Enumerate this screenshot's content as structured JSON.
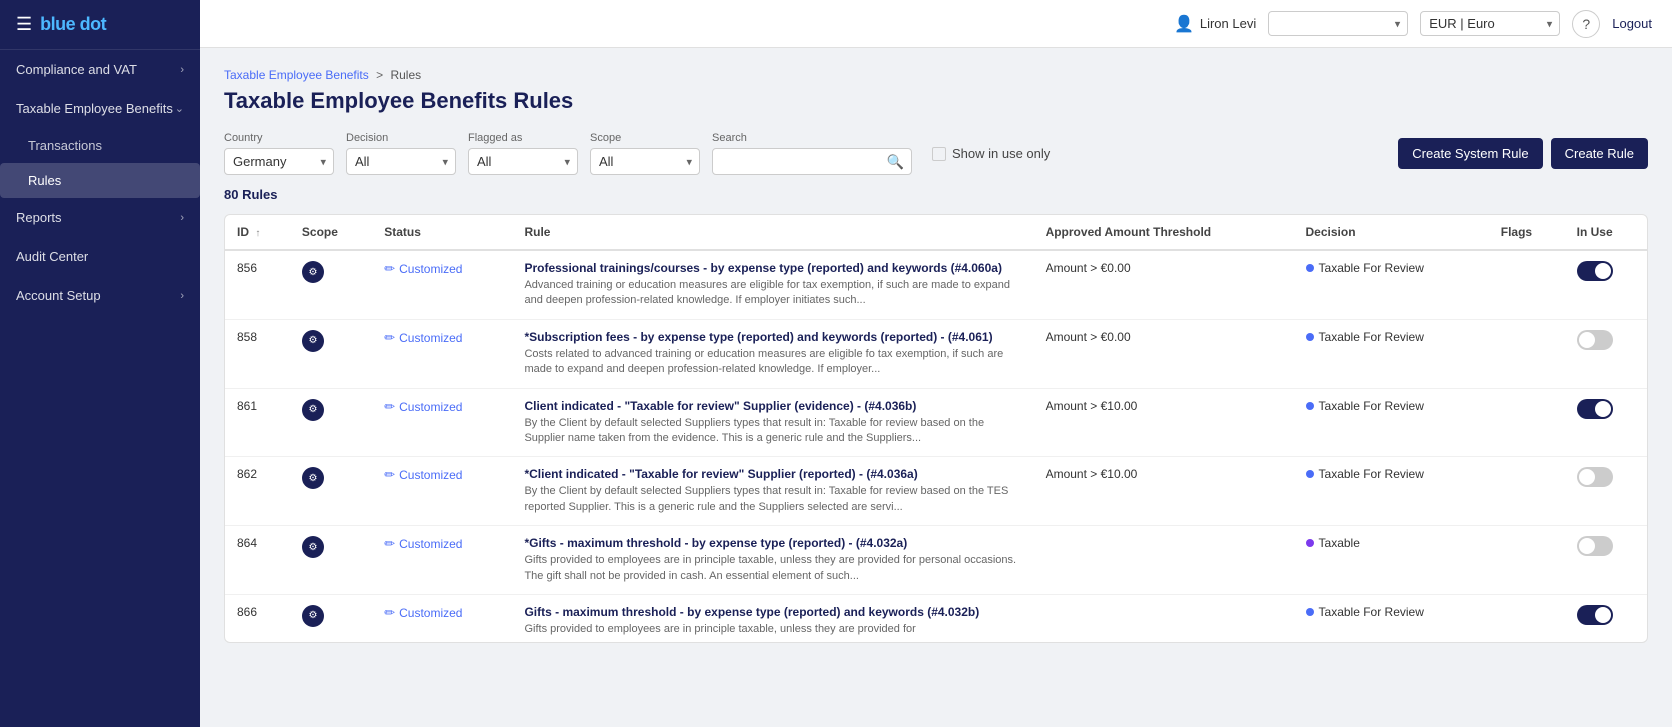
{
  "sidebar": {
    "logo": "blue dot",
    "items": [
      {
        "id": "compliance-vat",
        "label": "Compliance and VAT",
        "hasChevron": true,
        "expanded": true
      },
      {
        "id": "taxable-employee-benefits",
        "label": "Taxable Employee Benefits",
        "hasChevron": true,
        "expanded": true
      },
      {
        "id": "transactions",
        "label": "Transactions",
        "isSubItem": true
      },
      {
        "id": "rules",
        "label": "Rules",
        "isSubItem": true,
        "active": true
      },
      {
        "id": "reports",
        "label": "Reports",
        "hasChevron": true
      },
      {
        "id": "audit-center",
        "label": "Audit Center"
      },
      {
        "id": "account-setup",
        "label": "Account Setup",
        "hasChevron": true
      }
    ]
  },
  "topbar": {
    "user": "Liron Levi",
    "currency": "EUR | Euro",
    "currency_placeholder": "",
    "logout_label": "Logout",
    "help_icon": "?"
  },
  "breadcrumb": {
    "parent": "Taxable Employee Benefits",
    "separator": ">",
    "current": "Rules"
  },
  "page": {
    "title": "Taxable Employee Benefits Rules"
  },
  "filters": {
    "country_label": "Country",
    "country_value": "Germany",
    "decision_label": "Decision",
    "decision_value": "All",
    "flagged_as_label": "Flagged as",
    "flagged_as_value": "All",
    "scope_label": "Scope",
    "scope_value": "All",
    "search_label": "Search",
    "search_placeholder": "",
    "show_in_use_label": "Show in use only"
  },
  "actions": {
    "create_system_rule": "Create System Rule",
    "create_rule": "Create Rule"
  },
  "rules_count": "80 Rules",
  "table": {
    "columns": [
      "ID",
      "Scope",
      "Status",
      "Rule",
      "Approved Amount Threshold",
      "Decision",
      "Flags",
      "In Use"
    ],
    "rows": [
      {
        "id": "856",
        "scope": "global",
        "status": "Customized",
        "rule_name": "Professional trainings/courses - by expense type (reported) and keywords (#4.060a)",
        "rule_desc": "Advanced training or education measures are eligible for tax exemption, if such are made to expand and deepen profession-related knowledge. If employer initiates such...",
        "amount": "Amount > €0.00",
        "decision": "Taxable For Review",
        "decision_color": "blue",
        "flags": "",
        "in_use": true
      },
      {
        "id": "858",
        "scope": "global",
        "status": "Customized",
        "rule_name": "*Subscription fees - by expense type (reported) and keywords (reported) - (#4.061)",
        "rule_desc": "Costs related to advanced training or education measures are eligible fo tax exemption, if such are made to expand and deepen profession-related knowledge. If employer...",
        "amount": "Amount > €0.00",
        "decision": "Taxable For Review",
        "decision_color": "blue",
        "flags": "",
        "in_use": false
      },
      {
        "id": "861",
        "scope": "global",
        "status": "Customized",
        "rule_name": "Client indicated - \"Taxable for review\" Supplier (evidence) - (#4.036b)",
        "rule_desc": "By the Client by default selected Suppliers types that result in: Taxable for review based on the Supplier name taken from the evidence. This is a generic rule and the Suppliers...",
        "amount": "Amount > €10.00",
        "decision": "Taxable For Review",
        "decision_color": "blue",
        "flags": "",
        "in_use": true
      },
      {
        "id": "862",
        "scope": "global",
        "status": "Customized",
        "rule_name": "*Client indicated - \"Taxable for review\" Supplier (reported) - (#4.036a)",
        "rule_desc": "By the Client by default selected Suppliers types that result in: Taxable for review based on the TES reported Supplier. This is a generic rule and the Suppliers selected are servi...",
        "amount": "Amount > €10.00",
        "decision": "Taxable For Review",
        "decision_color": "blue",
        "flags": "",
        "in_use": false
      },
      {
        "id": "864",
        "scope": "global",
        "status": "Customized",
        "rule_name": "*Gifts - maximum threshold - by expense type (reported) - (#4.032a)",
        "rule_desc": "Gifts provided to employees are in principle taxable, unless they are provided for personal occasions. The gift shall not be provided in cash. An essential element of such...",
        "amount": "",
        "decision": "Taxable",
        "decision_color": "purple",
        "flags": "",
        "in_use": false
      },
      {
        "id": "866",
        "scope": "global",
        "status": "Customized",
        "rule_name": "Gifts - maximum threshold - by expense type (reported) and keywords (#4.032b)",
        "rule_desc": "Gifts provided to employees are in principle taxable, unless they are provided for",
        "amount": "",
        "decision": "Taxable For Review",
        "decision_color": "blue",
        "flags": "",
        "in_use": true
      }
    ]
  }
}
